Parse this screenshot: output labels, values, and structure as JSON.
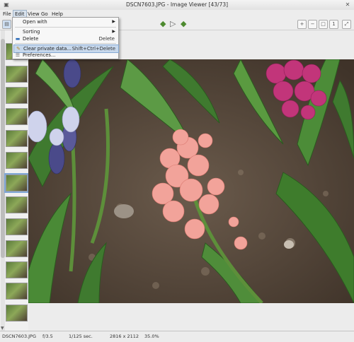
{
  "window": {
    "title": "DSCN7603.JPG - Image Viewer [43/73]",
    "controls": [
      "menu-icon",
      "close-icon"
    ]
  },
  "menubar": {
    "items": [
      {
        "label": "File"
      },
      {
        "label": "Edit"
      },
      {
        "label": "View"
      },
      {
        "label": "Go"
      },
      {
        "label": "Help"
      }
    ]
  },
  "edit_menu": {
    "items": [
      {
        "label": "Open with",
        "accel": "",
        "submenu": true,
        "icon": ""
      },
      {
        "label": "Sorting",
        "accel": "",
        "submenu": true,
        "icon": ""
      },
      {
        "label": "Delete",
        "accel": "Delete",
        "submenu": false,
        "icon": "delete-icon"
      },
      {
        "label": "Clear private data...",
        "accel": "Shift+Ctrl+Delete",
        "submenu": false,
        "icon": "broom-icon"
      },
      {
        "label": "Preferences...",
        "accel": "",
        "submenu": false,
        "icon": "preferences-icon"
      }
    ]
  },
  "toolbar": {
    "buttons": [
      "back-icon",
      "slideshow-play-icon",
      "forward-icon",
      "zoom-in-icon",
      "zoom-out-icon",
      "zoom-fit-icon",
      "zoom-100-icon",
      "fullscreen-icon"
    ]
  },
  "status": {
    "filename": "DSCN7603.JPG",
    "aperture": "f/3.5",
    "exposure": "1/125 sec.",
    "dimensions": "2816 x 2112",
    "zoom": "35.0%"
  },
  "thumbnails": {
    "count_visible": 14,
    "selected_index": 6
  }
}
